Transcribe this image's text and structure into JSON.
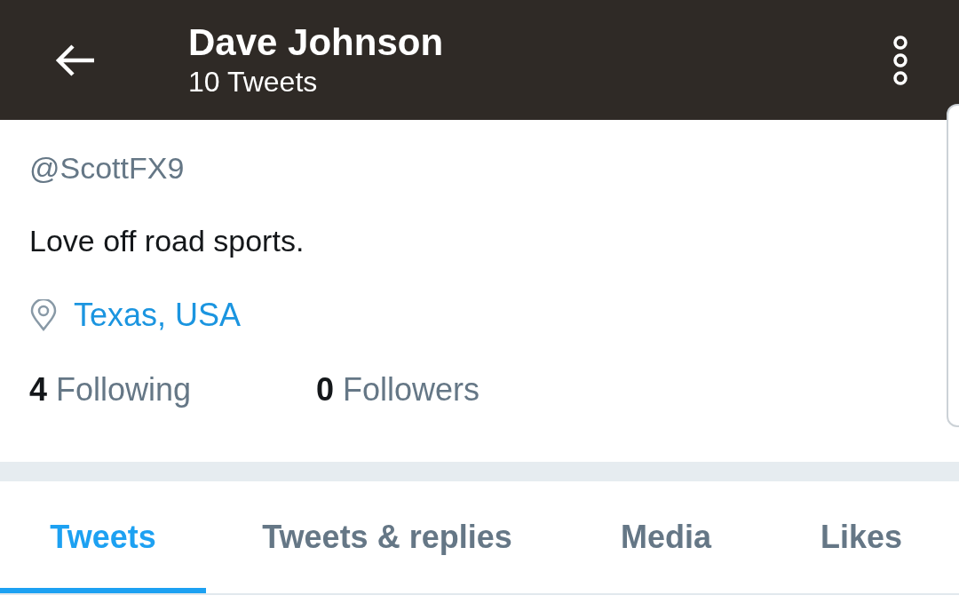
{
  "header": {
    "title": "Dave Johnson",
    "subtitle": "10 Tweets"
  },
  "profile": {
    "handle": "@ScottFX9",
    "bio": "Love off road sports.",
    "location": "Texas, USA",
    "stats": [
      {
        "count": "4",
        "label": "Following"
      },
      {
        "count": "0",
        "label": "Followers"
      }
    ]
  },
  "tabs": [
    {
      "label": "Tweets",
      "selected": true
    },
    {
      "label": "Tweets & replies",
      "selected": false
    },
    {
      "label": "Media",
      "selected": false
    },
    {
      "label": "Likes",
      "selected": false
    }
  ]
}
